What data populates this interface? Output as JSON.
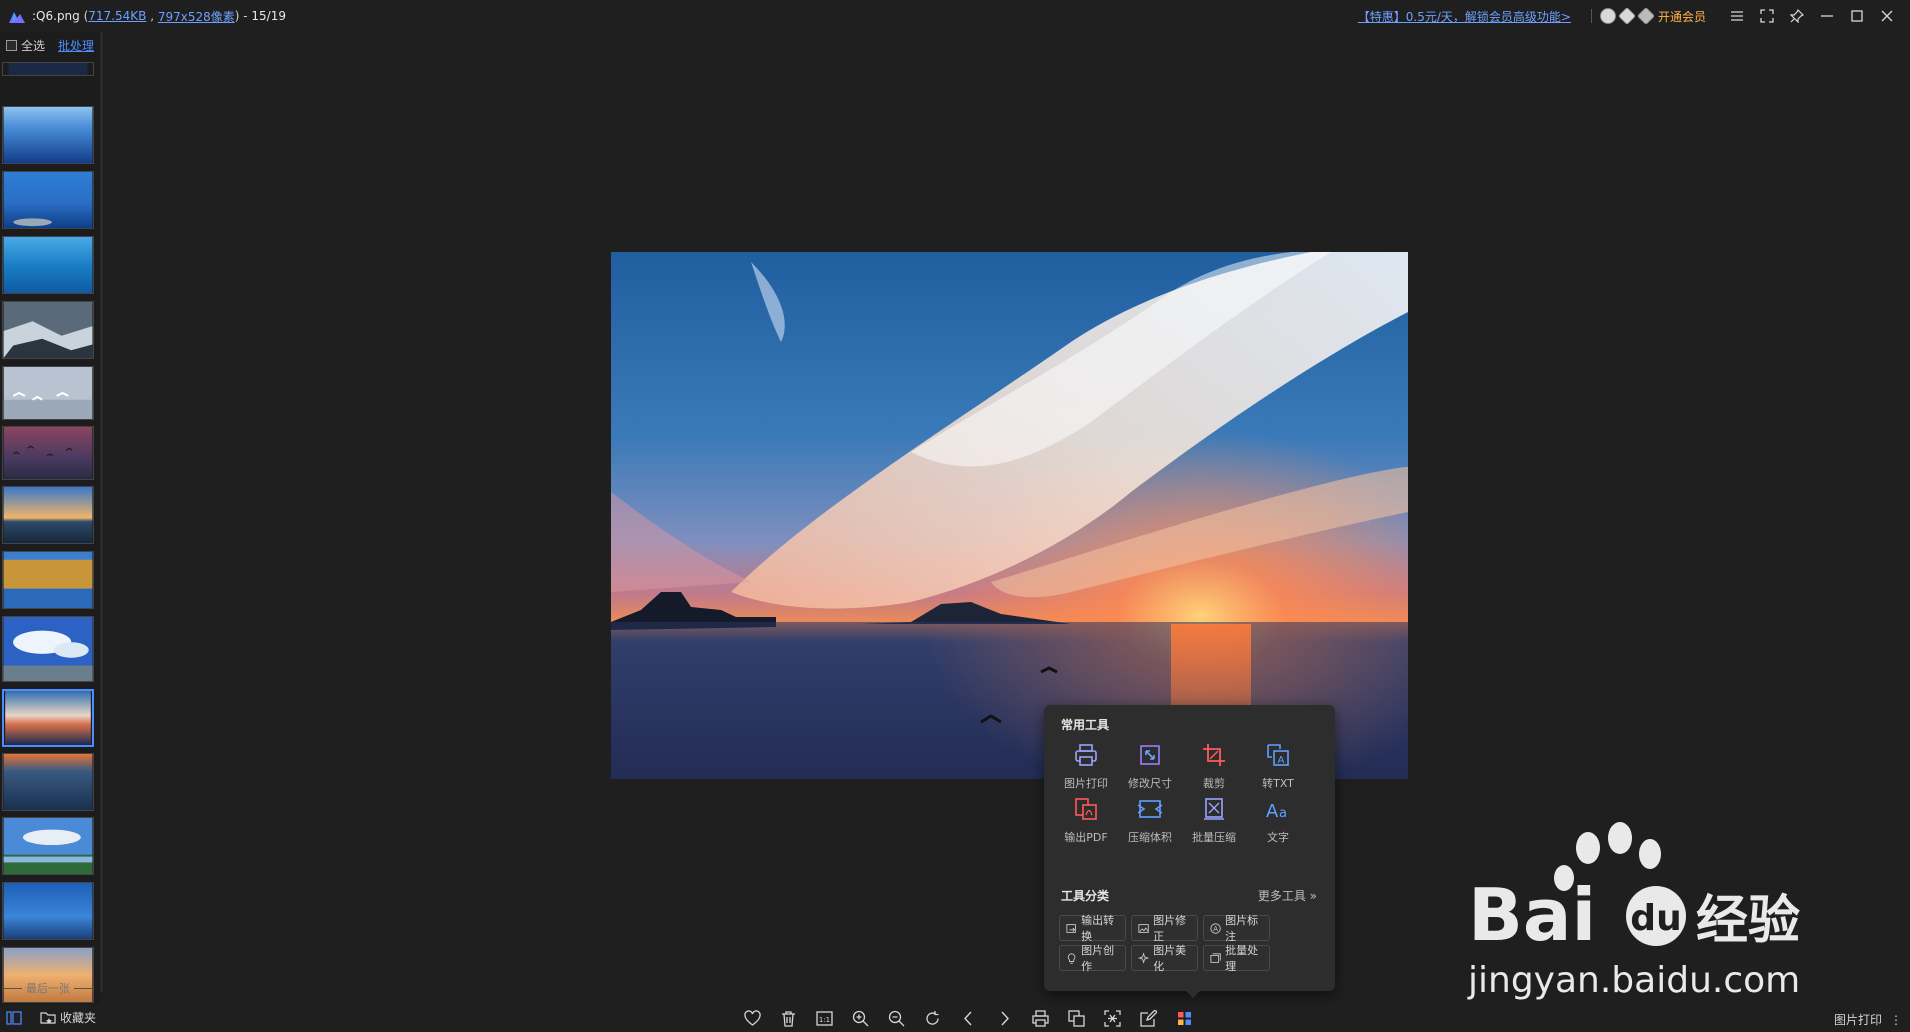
{
  "titlebar": {
    "filename": "Q6.png",
    "filesize": "717.54KB",
    "dimensions": "797x528像素",
    "position": "15/19",
    "promo": "【特惠】0.5元/天，解锁会员高级功能>",
    "vip_label": "开通会员",
    "icons": [
      "menu-icon",
      "fullscreen-icon",
      "pin-icon",
      "minimize-icon",
      "maximize-icon",
      "close-icon"
    ]
  },
  "sidebar": {
    "select_all": "全选",
    "batch": "批处理",
    "end_label": "最后一张",
    "selected_index": 9,
    "thumb_count": 14
  },
  "tools_popup": {
    "common_title": "常用工具",
    "common_tools": [
      {
        "label": "图片打印",
        "icon": "printer-icon"
      },
      {
        "label": "修改尺寸",
        "icon": "resize-icon"
      },
      {
        "label": "裁剪",
        "icon": "crop-icon"
      },
      {
        "label": "转TXT",
        "icon": "to-text-icon"
      },
      {
        "label": "输出PDF",
        "icon": "pdf-icon"
      },
      {
        "label": "压缩体积",
        "icon": "compress-icon"
      },
      {
        "label": "批量压缩",
        "icon": "batch-compress-icon"
      },
      {
        "label": "文字",
        "icon": "text-icon"
      }
    ],
    "category_title": "工具分类",
    "more_tools": "更多工具 »",
    "categories": [
      {
        "label": "输出转换",
        "icon": "convert-icon"
      },
      {
        "label": "图片修正",
        "icon": "image-fix-icon"
      },
      {
        "label": "图片标注",
        "icon": "annotate-icon"
      },
      {
        "label": "图片创作",
        "icon": "bulb-icon"
      },
      {
        "label": "图片美化",
        "icon": "sparkle-icon"
      },
      {
        "label": "批量处理",
        "icon": "batch-icon"
      }
    ]
  },
  "bottombar": {
    "favorites": "收藏夹",
    "print_label": "图片打印",
    "icons": [
      "heart-icon",
      "trash-icon",
      "actual-size-icon",
      "zoom-in-icon",
      "zoom-out-icon",
      "rotate-icon",
      "prev-icon",
      "next-icon",
      "print-icon",
      "copy-icon",
      "scan-icon",
      "edit-icon",
      "apps-icon"
    ]
  },
  "watermark": {
    "brand": "Bai",
    "brand2": "du",
    "cn": "经验",
    "url": "jingyan.baidu.com"
  },
  "colors": {
    "accent": "#4d8cff",
    "vip": "#ffb347",
    "background": "#1f1f1f"
  }
}
